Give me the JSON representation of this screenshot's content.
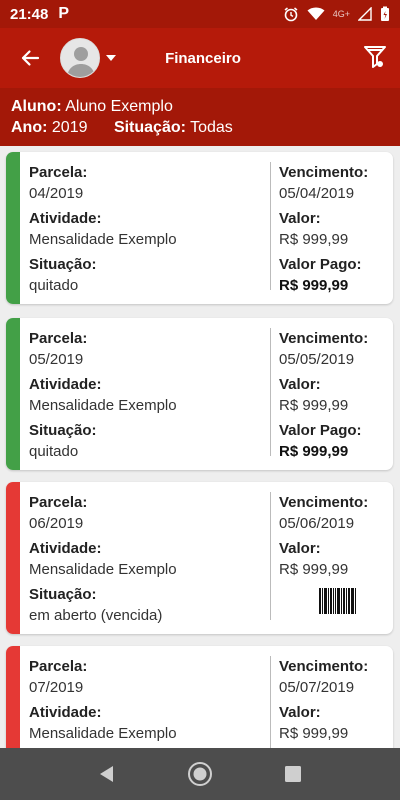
{
  "status_bar": {
    "time": "21:48",
    "app_icon": "P",
    "network": "4G+"
  },
  "toolbar": {
    "title": "Financeiro"
  },
  "info": {
    "aluno_label": "Aluno:",
    "aluno_value": "Aluno Exemplo",
    "ano_label": "Ano:",
    "ano_value": "2019",
    "situacao_label": "Situação:",
    "situacao_value": "Todas"
  },
  "labels": {
    "parcela": "Parcela:",
    "atividade": "Atividade:",
    "situacao": "Situação:",
    "vencimento": "Vencimento:",
    "valor": "Valor:",
    "valor_pago": "Valor Pago:"
  },
  "colors": {
    "paid": "#43a047",
    "overdue": "#e53935",
    "brand": "#b51a0a"
  },
  "cards": [
    {
      "parcela": "04/2019",
      "atividade": "Mensalidade Exemplo",
      "situacao": "quitado",
      "vencimento": "05/04/2019",
      "valor": "R$ 999,99",
      "valor_pago": "R$ 999,99"
    },
    {
      "parcela": "05/2019",
      "atividade": "Mensalidade Exemplo",
      "situacao": "quitado",
      "vencimento": "05/05/2019",
      "valor": "R$ 999,99",
      "valor_pago": "R$ 999,99"
    },
    {
      "parcela": "06/2019",
      "atividade": "Mensalidade Exemplo",
      "situacao": "em aberto (vencida)",
      "vencimento": "05/06/2019",
      "valor": "R$ 999,99"
    },
    {
      "parcela": "07/2019",
      "atividade": "Mensalidade Exemplo",
      "vencimento": "05/07/2019",
      "valor": "R$ 999,99"
    }
  ]
}
